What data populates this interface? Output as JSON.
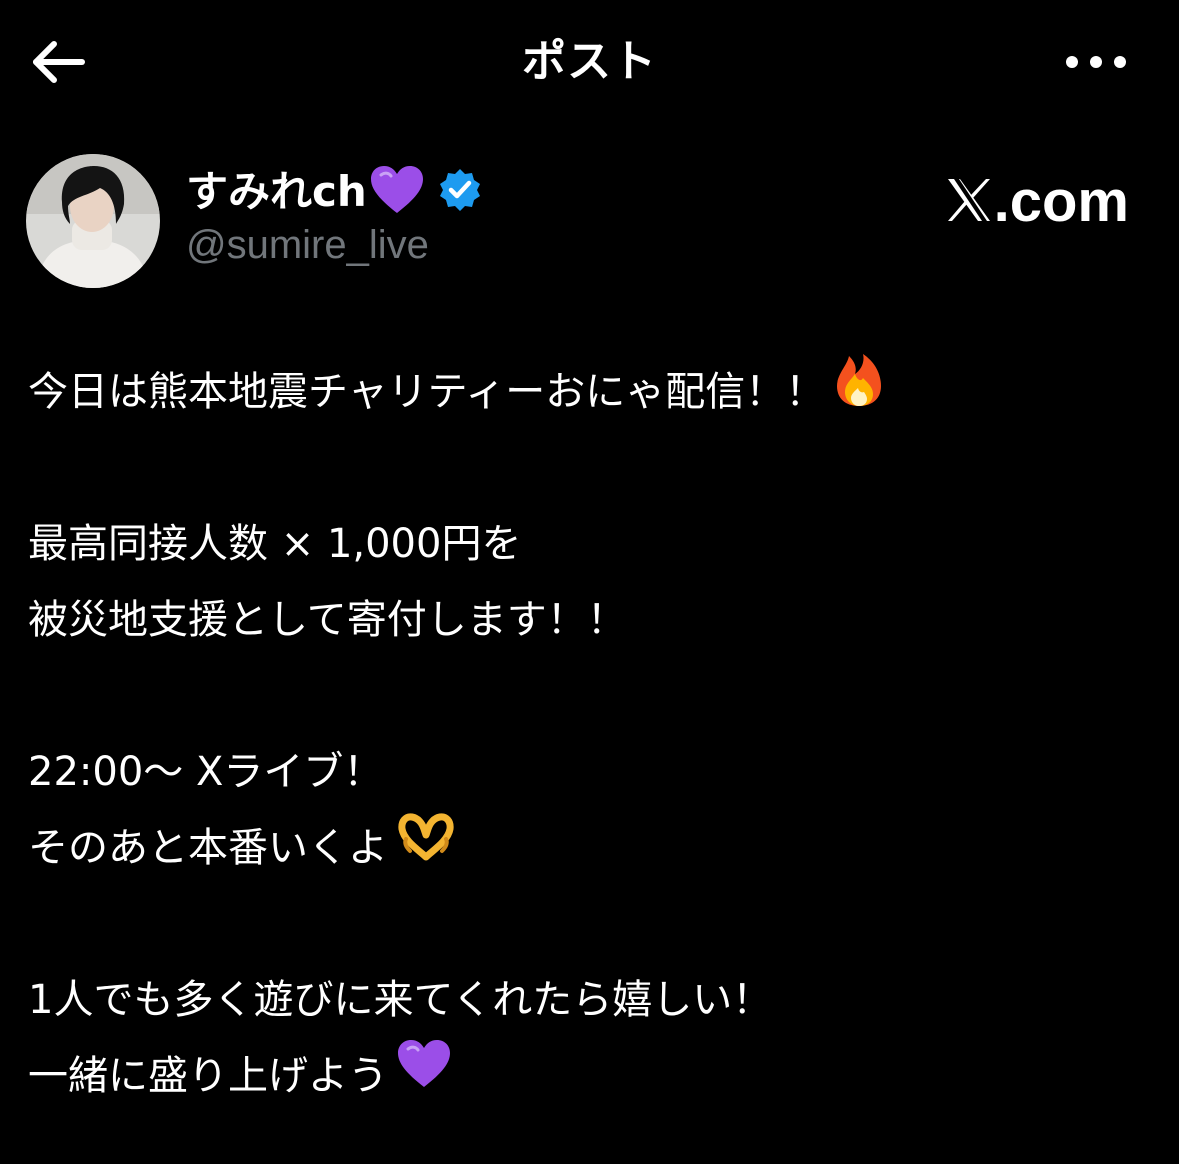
{
  "header": {
    "title": "ポスト",
    "back_icon": "arrow-left-icon",
    "more_icon": "more-horizontal-icon"
  },
  "author": {
    "display_name": "すみれch",
    "name_emoji": "purple-heart-icon",
    "handle": "@sumire_live",
    "verified": true,
    "verified_color": "#1d9bf0"
  },
  "watermark": {
    "logo": "x-logo-icon",
    "text": ".com"
  },
  "post": {
    "lines": [
      "今日は熊本地震チャリティーおにゃ配信！！",
      "最高同接人数 × 1,000円を",
      "被災地支援として寄付します！！",
      "22:00〜 Xライブ！",
      "そのあと本番いくよ",
      "1人でも多く遊びに来てくれたら嬉しい！",
      "一緒に盛り上げよう"
    ],
    "emojis": [
      "fire-icon",
      "heart-hands-icon",
      "purple-heart-icon"
    ]
  },
  "colors": {
    "background": "#000000",
    "text": "#ffffff",
    "secondary_text": "#71767b",
    "purple_heart": "#9b4ee8"
  }
}
